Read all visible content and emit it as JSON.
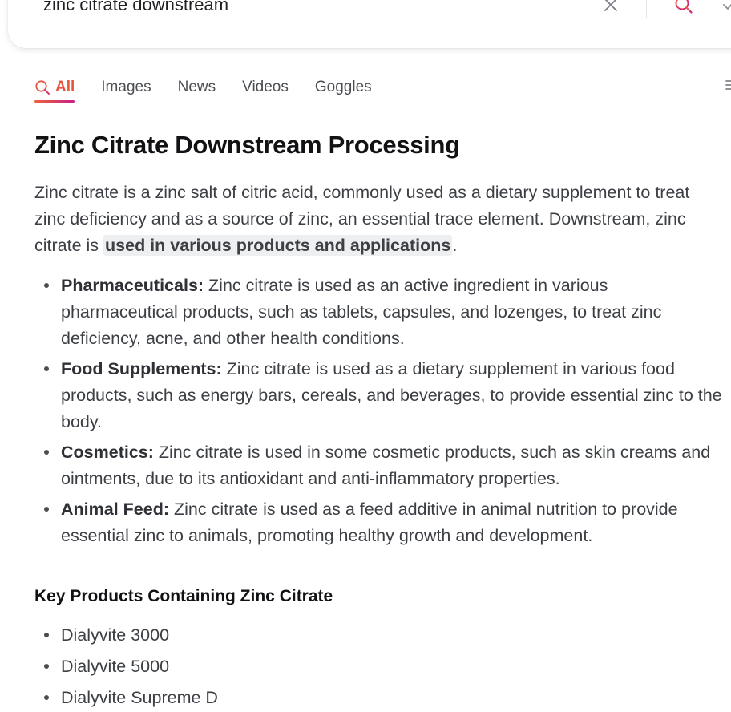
{
  "search": {
    "query": "zinc citrate downstream",
    "clear_icon": "close-icon",
    "search_icon": "search-icon",
    "confirm_icon": "check-icon"
  },
  "tabs": [
    {
      "label": "All",
      "active": true,
      "icon": "search-icon"
    },
    {
      "label": "Images"
    },
    {
      "label": "News"
    },
    {
      "label": "Videos"
    },
    {
      "label": "Goggles"
    }
  ],
  "article": {
    "title": "Zinc Citrate Downstream Processing",
    "intro_plain": "Zinc citrate is a zinc salt of citric acid, commonly used as a dietary supplement to treat zinc deficiency and as a source of zinc, an essential trace element. Downstream, zinc citrate is ",
    "intro_highlight": "used in various products and applications",
    "intro_end": ".",
    "uses": [
      {
        "term": "Pharmaceuticals:",
        "text": " Zinc citrate is used as an active ingredient in various pharmaceutical products, such as tablets, capsules, and lozenges, to treat zinc deficiency, acne, and other health conditions."
      },
      {
        "term": "Food Supplements:",
        "text": " Zinc citrate is used as a dietary supplement in various food products, such as energy bars, cereals, and beverages, to provide essential zinc to the body."
      },
      {
        "term": "Cosmetics:",
        "text": " Zinc citrate is used in some cosmetic products, such as skin creams and ointments, due to its antioxidant and anti-inflammatory properties."
      },
      {
        "term": "Animal Feed:",
        "text": " Zinc citrate is used as a feed additive in animal nutrition to provide essential zinc to animals, promoting healthy growth and development."
      }
    ],
    "products_heading": "Key Products Containing Zinc Citrate",
    "products": [
      "Dialyvite 3000",
      "Dialyvite 5000",
      "Dialyvite Supreme D"
    ]
  },
  "colors": {
    "accent": "#e8553d",
    "accent_gradient_end": "#c51f8b",
    "text": "#3c3f44",
    "heading": "#111214",
    "highlight_bg": "#eeeff1"
  }
}
